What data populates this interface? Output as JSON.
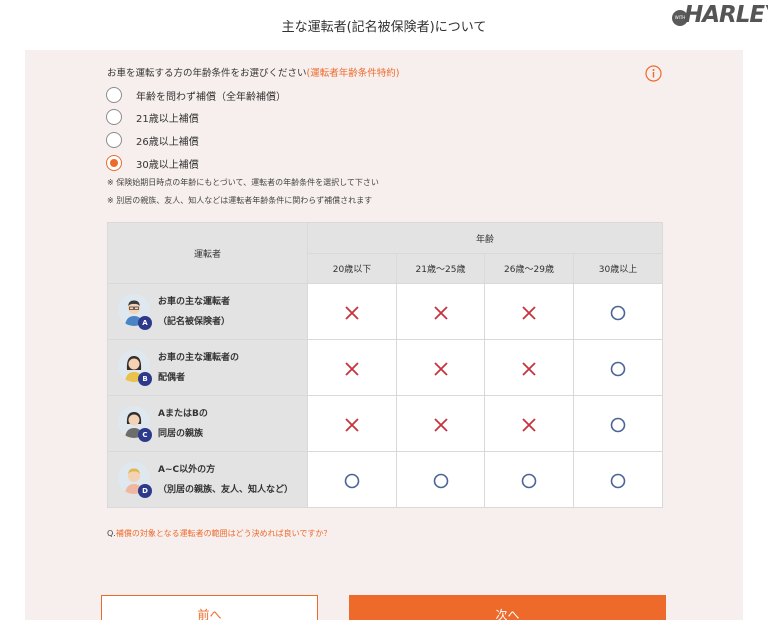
{
  "header": {
    "title": "主な運転者(記名被保険者)について"
  },
  "logo": {
    "small_text": "WITH",
    "brand": "HARLEY"
  },
  "question": {
    "text": "お車を運転する方の年齢条件をお選びください",
    "tag": "(運転者年齢条件特約)",
    "info_icon": "info-circle-icon"
  },
  "options": [
    {
      "label": "年齢を問わず補償（全年齢補償）",
      "checked": false
    },
    {
      "label": "21歳以上補償",
      "checked": false
    },
    {
      "label": "26歳以上補償",
      "checked": false
    },
    {
      "label": "30歳以上補償",
      "checked": true
    }
  ],
  "notes": [
    "※ 保険始期日時点の年齢にもとづいて、運転者の年齢条件を選択して下さい",
    "※ 別居の親族、友人、知人などは運転者年齢条件に関わらず補償されます"
  ],
  "table": {
    "driver_header": "運転者",
    "age_header": "年齢",
    "age_columns": [
      "20歳以下",
      "21歳〜25歳",
      "26歳〜29歳",
      "30歳以上"
    ],
    "rows": [
      {
        "badge": "A",
        "line1": "お車の主な運転者",
        "line2": "（記名被保険者）",
        "marks": [
          "x",
          "x",
          "x",
          "o"
        ]
      },
      {
        "badge": "B",
        "line1": "お車の主な運転者の",
        "line2": "配偶者",
        "marks": [
          "x",
          "x",
          "x",
          "o"
        ]
      },
      {
        "badge": "C",
        "line1": "AまたはBの",
        "line2": "同居の親族",
        "marks": [
          "x",
          "x",
          "x",
          "o"
        ]
      },
      {
        "badge": "D",
        "line1": "A~C以外の方",
        "line2": "（別居の親族、友人、知人など）",
        "marks": [
          "o",
          "o",
          "o",
          "o"
        ]
      }
    ]
  },
  "faq": {
    "prefix": "Q.",
    "link": "補償の対象となる運転者の範囲はどう決めれば良いですか？"
  },
  "buttons": {
    "prev": "前へ",
    "next": "次へ"
  },
  "colors": {
    "accent": "#ee6a2a",
    "cross": "#c8323c",
    "circle": "#4a6496",
    "badge": "#2d3a8c",
    "panel": "#f6efee"
  }
}
